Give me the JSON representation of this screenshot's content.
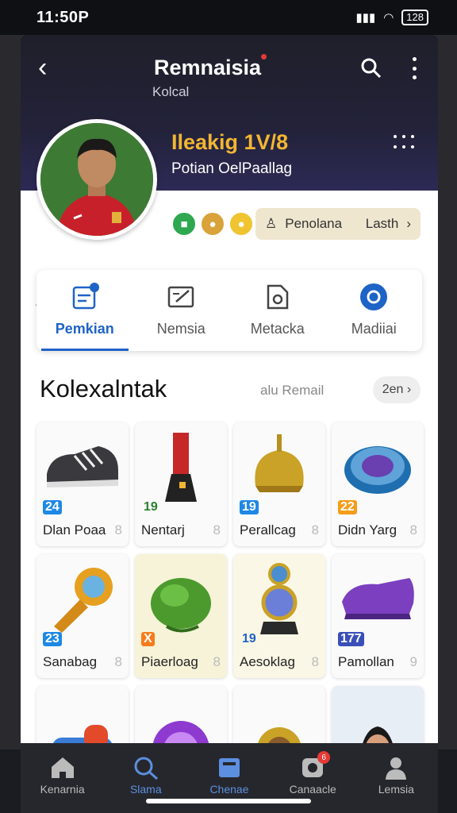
{
  "status": {
    "time": "11:50P",
    "battery": "128"
  },
  "header": {
    "title": "Remnaisia",
    "subtitle": "Kolcal"
  },
  "profile": {
    "name": "Ileakig 1V/8",
    "role": "Potian OelPaallag"
  },
  "pill": {
    "label": "Penolana",
    "value": "Lasth"
  },
  "tabs": [
    {
      "label": "Pemkian",
      "icon": "document-icon"
    },
    {
      "label": "Nemsia",
      "icon": "edit-card-icon"
    },
    {
      "label": "Metacka",
      "icon": "camera-doc-icon"
    },
    {
      "label": "Madiiai",
      "icon": "target-icon"
    }
  ],
  "section": {
    "title": "Kolexalntak",
    "subtitle": "alu Remail",
    "see_all": "2en"
  },
  "items": [
    {
      "name": "Dlan Poaa",
      "level": "24",
      "count": "8"
    },
    {
      "name": "Nentarj",
      "level": "19",
      "count": "8"
    },
    {
      "name": "Perallcag",
      "level": "19",
      "count": "8"
    },
    {
      "name": "Didn Yarg",
      "level": "22",
      "count": "8"
    },
    {
      "name": "Sanabag",
      "level": "23",
      "count": "8"
    },
    {
      "name": "Piaerloag",
      "level": "X",
      "count": "8"
    },
    {
      "name": "Aesoklag",
      "level": "19",
      "count": "8"
    },
    {
      "name": "Pamollan",
      "level": "177",
      "count": "9"
    },
    {
      "name": "",
      "level": "",
      "count": ""
    },
    {
      "name": "",
      "level": "",
      "count": ""
    },
    {
      "name": "",
      "level": "",
      "count": ""
    },
    {
      "name": "",
      "level": "",
      "count": ""
    }
  ],
  "nav": [
    {
      "label": "Kenarnia",
      "icon": "home-icon"
    },
    {
      "label": "Slama",
      "icon": "search-icon"
    },
    {
      "label": "Chenae",
      "icon": "collection-icon"
    },
    {
      "label": "Canaacle",
      "icon": "game-icon",
      "badge": "6"
    },
    {
      "label": "Lemsia",
      "icon": "person-icon"
    }
  ],
  "colors": {
    "accent": "#1e63c6",
    "gold": "#f2b632",
    "hero": "#232239"
  }
}
